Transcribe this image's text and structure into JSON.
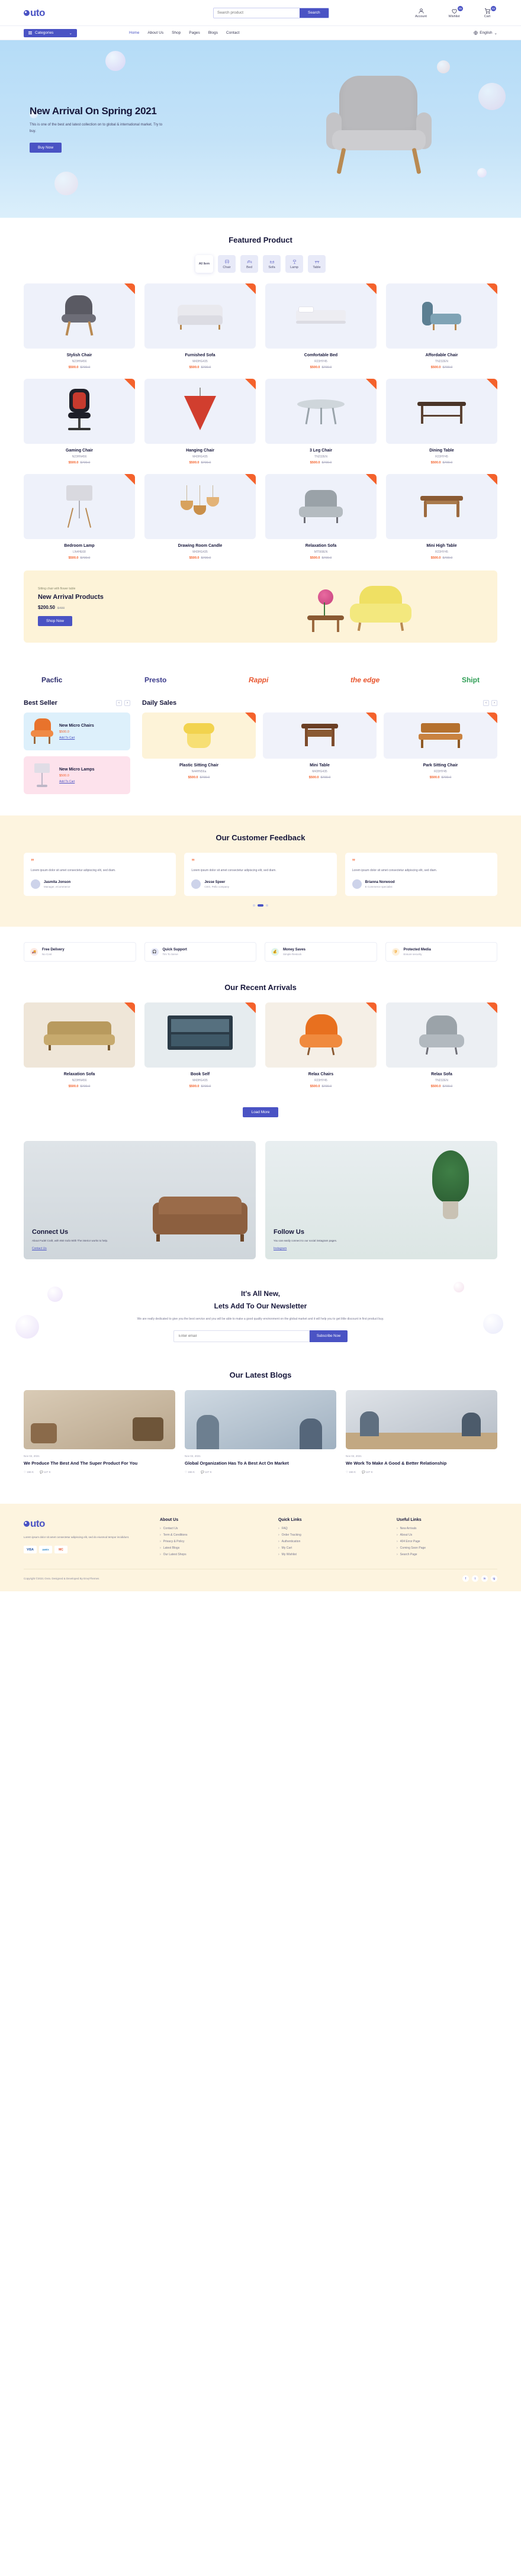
{
  "brand": {
    "name": "uto",
    "accent": "#4a53c4",
    "orange": "#f4622c"
  },
  "header": {
    "search": {
      "placeholder": "Search product",
      "value": "",
      "button": "Search"
    },
    "actions": [
      {
        "label": "Account",
        "icon": "user-icon",
        "badge": ""
      },
      {
        "label": "Wishlist",
        "icon": "heart-icon",
        "badge": "05"
      },
      {
        "label": "Cart",
        "icon": "cart-icon",
        "badge": "02"
      }
    ]
  },
  "nav": {
    "categories_label": "Categories",
    "links": [
      {
        "label": "Home",
        "caret": true,
        "active": true
      },
      {
        "label": "About Us",
        "caret": false,
        "active": false
      },
      {
        "label": "Shop",
        "caret": true,
        "active": false
      },
      {
        "label": "Pages",
        "caret": true,
        "active": false
      },
      {
        "label": "Blogs",
        "caret": true,
        "active": false
      },
      {
        "label": "Contact",
        "caret": false,
        "active": false
      }
    ],
    "language": "English"
  },
  "hero": {
    "title": "New Arrival On Spring 2021",
    "text": "This is one of the best and latest collection on to global & international market. Try to buy.",
    "cta": "Buy Now"
  },
  "featured": {
    "title": "Featured Product",
    "tabs": [
      {
        "label": "All Item",
        "icon": "grid-icon",
        "active": true
      },
      {
        "label": "Chair",
        "icon": "chair-icon",
        "active": false
      },
      {
        "label": "Bed",
        "icon": "bed-icon",
        "active": false
      },
      {
        "label": "Sofa",
        "icon": "sofa-icon",
        "active": false
      },
      {
        "label": "Lamp",
        "icon": "lamp-icon",
        "active": false
      },
      {
        "label": "Table",
        "icon": "table-icon",
        "active": false
      }
    ],
    "products": [
      {
        "name": "Stylish Chair",
        "code": "N23HN456",
        "price": "$500.0",
        "old": "$700.0"
      },
      {
        "name": "Furnished Sofa",
        "code": "M43HG435",
        "price": "$500.0",
        "old": "$700.0"
      },
      {
        "name": "Comfortable Bed",
        "code": "R23HY45",
        "price": "$500.0",
        "old": "$700.0"
      },
      {
        "name": "Affordable Chair",
        "code": "TN232EN",
        "price": "$500.0",
        "old": "$700.0"
      },
      {
        "name": "Gaming Chair",
        "code": "N23HN456",
        "price": "$500.0",
        "old": "$700.0"
      },
      {
        "name": "Hanging Chair",
        "code": "M43HG435",
        "price": "$500.0",
        "old": "$700.0"
      },
      {
        "name": "3 Leg Chair",
        "code": "TN232EN",
        "price": "$500.0",
        "old": "$700.0"
      },
      {
        "name": "Dining Table",
        "code": "R23HY45",
        "price": "$500.0",
        "old": "$700.0"
      },
      {
        "name": "Bedroom Lamp",
        "code": "LN4HE68",
        "price": "$500.0",
        "old": "$700.0"
      },
      {
        "name": "Drawing Room Candle",
        "code": "M43HG435",
        "price": "$500.0",
        "old": "$700.0"
      },
      {
        "name": "Relaxation Sofa",
        "code": "MT569EN",
        "price": "$500.0",
        "old": "$700.0"
      },
      {
        "name": "Mini High Table",
        "code": "R23HY45",
        "price": "$500.0",
        "old": "$700.0"
      }
    ]
  },
  "promo": {
    "kicker": "Sitting chair with flower table",
    "title": "New Arrival Products",
    "price": "$200.50",
    "old": "$400",
    "cta": "Shop Now"
  },
  "brands": [
    {
      "name": "Pacfic"
    },
    {
      "name": "Presto"
    },
    {
      "name": "Rappi"
    },
    {
      "name": "the edge"
    },
    {
      "name": "Shipt"
    }
  ],
  "bestseller": {
    "title": "Best Seller",
    "items": [
      {
        "name": "New Micro Chairs",
        "price": "$500.0",
        "link": "Add To Cart",
        "theme": "blue"
      },
      {
        "name": "New Micro Lamps",
        "price": "$500.0",
        "link": "Add To Cart",
        "theme": "pink"
      }
    ]
  },
  "dailysales": {
    "title": "Daily Sales",
    "items": [
      {
        "name": "Plastic Sitting Chair",
        "code": "N44HN56a",
        "price": "$500.0",
        "old": "$700.0"
      },
      {
        "name": "Mini Table",
        "code": "M43HG435",
        "price": "$500.0",
        "old": "$700.0"
      },
      {
        "name": "Park Sitting Chair",
        "code": "R23HY45",
        "price": "$500.0",
        "old": "$700.0"
      }
    ]
  },
  "feedback": {
    "title": "Our Customer Feedback",
    "cards": [
      {
        "text": "Lorem ipsum dolor sit amet consectetur adipiscing elit, sed diam.",
        "name": "Jasmita Jonson",
        "role": "Manager, eCommerce"
      },
      {
        "text": "Lorem ipsum dolor sit amet consectetur adipiscing elit, sed diam.",
        "name": "Jesse Speer",
        "role": "CEO, Pello company"
      },
      {
        "text": "Lorem ipsum dolor sit amet consectetur adipiscing elit, sed diam.",
        "name": "Brianna Norwood",
        "role": "E Commerce specialist"
      }
    ]
  },
  "features": [
    {
      "title": "Free Delivery",
      "sub": "No Cost",
      "icon": "truck-icon",
      "color": "#f4622c"
    },
    {
      "title": "Quick Support",
      "sub": "Tim To Serve",
      "icon": "headset-icon",
      "color": "#4a53c4"
    },
    {
      "title": "Money Saves",
      "sub": "Simple Restock",
      "icon": "coin-icon",
      "color": "#2cb56b"
    },
    {
      "title": "Protected Media",
      "sub": "Ensure security",
      "icon": "shield-icon",
      "color": "#f4a62c"
    }
  ],
  "arrivals": {
    "title": "Our Recent Arrivals",
    "products": [
      {
        "name": "Relaxation Sofa",
        "code": "N23HN456",
        "price": "$500.0",
        "old": "$700.0"
      },
      {
        "name": "Book Self",
        "code": "M43HG435",
        "price": "$500.0",
        "old": "$700.0"
      },
      {
        "name": "Relax Chairs",
        "code": "R23HY45",
        "price": "$500.0",
        "old": "$700.0"
      },
      {
        "name": "Relax Sofa",
        "code": "TN232EN",
        "price": "$500.0",
        "old": "$700.0"
      }
    ],
    "cta": "Load More"
  },
  "connect": {
    "title": "Connect Us",
    "text": "About Fudel Craft, with 850 Sofa With The interior works to help.",
    "link": "Contact Us"
  },
  "follow": {
    "title": "Follow Us",
    "text": "You can easily connect to our social instagram pages.",
    "link": "Instagram"
  },
  "newsletter": {
    "title_1": "It's All New,",
    "title_2": "Lets Add To Our Newsletter",
    "text": "We are really dedicated to give you the best service and you will be able to make a good quality environment on the global market and it will help you to get little discount in first product buy.",
    "placeholder": "Enter email",
    "cta": "Subscribe Now"
  },
  "blogs": {
    "title": "Our Latest Blogs",
    "posts": [
      {
        "date": "Nov 02, 2021",
        "title": "We Produce The Best And The Super Product For You",
        "likes": "156 K",
        "comments": "127 K"
      },
      {
        "date": "Nov 02, 2021",
        "title": "Global Organization Has To A Best Act On Market",
        "likes": "156 K",
        "comments": "127 K"
      },
      {
        "date": "Nov 02, 2021",
        "title": "We Work To Make A Good & Better Relationship",
        "likes": "156 K",
        "comments": "127 K"
      }
    ]
  },
  "footer": {
    "about": "Lorem ipsum dolor sit amet consectetur adipiscing elit, sed do eiusmod tempor incididunt.",
    "payments": [
      "VISA",
      "AMEX",
      "MC"
    ],
    "columns": [
      {
        "title": "About Us",
        "items": [
          "Contact Us",
          "Term & Conditions",
          "Privacy & Policy",
          "Latest Blogs",
          "Our Latest Shops"
        ]
      },
      {
        "title": "Quick Links",
        "items": [
          "FAQ",
          "Order Tracking",
          "Authentication",
          "My Cart",
          "My Wishlist"
        ]
      },
      {
        "title": "Useful Links",
        "items": [
          "New Arrivals",
          "About Us",
          "404 Error Page",
          "Coming Soon Page",
          "Search Page"
        ]
      }
    ],
    "copyright": "Copyright ©2021 Ovra. Designed & Developed By EnvyThemes",
    "socials": [
      "f",
      "t",
      "in",
      "ig"
    ]
  }
}
